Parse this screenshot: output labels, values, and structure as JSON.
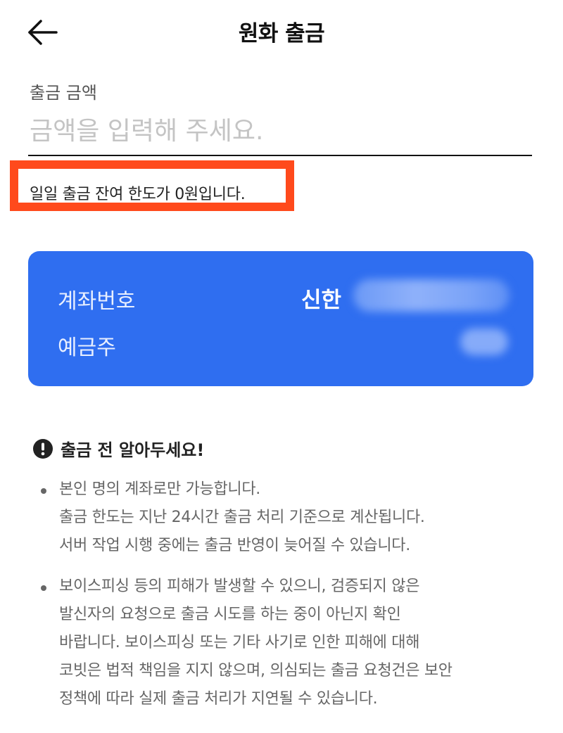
{
  "header": {
    "title": "원화 출금",
    "back_icon": "arrow-left-icon"
  },
  "amount": {
    "label": "출금 금액",
    "placeholder": "금액을 입력해 주세요.",
    "value": ""
  },
  "limit_message": "일일 출금 잔여 한도가 0원입니다.",
  "account_card": {
    "account_label": "계좌번호",
    "owner_label": "예금주",
    "bank_name": "신한",
    "card_color": "#2f6ef0"
  },
  "notice": {
    "icon": "alert-circle-icon",
    "title": "출금 전 알아두세요!",
    "bullets": [
      {
        "lines": [
          "본인 명의 계좌로만 가능합니다.",
          "출금 한도는 지난 24시간 출금 처리 기준으로 계산됩니다.",
          "서버 작업 시행 중에는 출금 반영이 늦어질 수 있습니다."
        ]
      },
      {
        "lines": [
          "보이스피싱 등의 피해가 발생할 수 있으니, 검증되지 않은",
          "발신자의 요청으로 출금 시도를 하는 중이 아닌지 확인",
          "바랍니다. 보이스피싱 또는 기타 사기로 인한 피해에 대해",
          "코빗은 법적 책임을 지지 않으며, 의심되는 출금 요청건은 보안",
          "정책에 따라 실제 출금 처리가 지연될 수 있습니다."
        ]
      }
    ]
  },
  "colors": {
    "highlight": "#ff4a1c",
    "accent": "#2f6ef0"
  }
}
